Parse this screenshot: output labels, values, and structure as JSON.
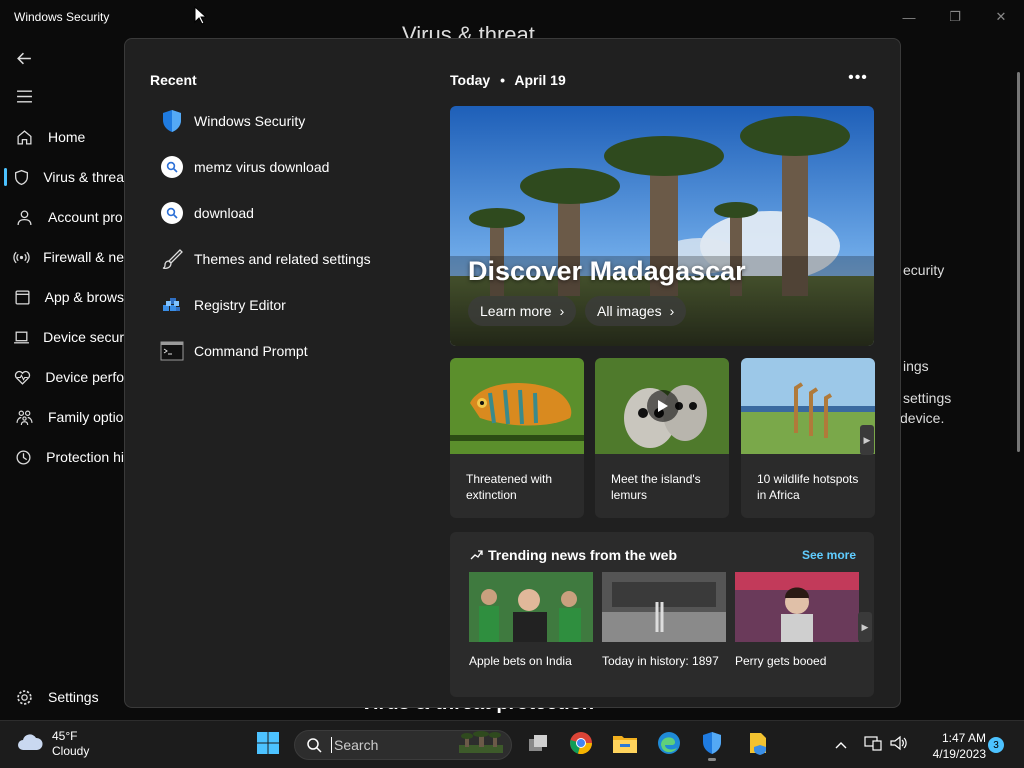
{
  "window": {
    "title": "Windows Security",
    "top_title_fragment": "Virus & threat",
    "bottom_title_fragment": "Virus & threat protection"
  },
  "sidebar": {
    "items": [
      {
        "label": "Home",
        "icon": "home-icon"
      },
      {
        "label": "Virus & threa",
        "icon": "shield-icon",
        "active": true
      },
      {
        "label": "Account pro",
        "icon": "person-icon"
      },
      {
        "label": "Firewall & ne",
        "icon": "wifi-icon"
      },
      {
        "label": "App & brows",
        "icon": "app-icon"
      },
      {
        "label": "Device secur",
        "icon": "laptop-icon"
      },
      {
        "label": "Device perfo",
        "icon": "heart-icon"
      },
      {
        "label": "Family optio",
        "icon": "family-icon"
      },
      {
        "label": "Protection hi",
        "icon": "history-icon"
      }
    ],
    "settings_label": "Settings"
  },
  "background_right": {
    "line1": "ecurity",
    "line2": "ings",
    "line3": "settings",
    "line4": "device."
  },
  "recent": {
    "heading": "Recent",
    "items": [
      {
        "label": "Windows Security",
        "icon": "windows-security-icon"
      },
      {
        "label": "memz virus download",
        "icon": "search-icon"
      },
      {
        "label": "download",
        "icon": "search-icon"
      },
      {
        "label": "Themes and related settings",
        "icon": "brush-icon"
      },
      {
        "label": "Registry Editor",
        "icon": "registry-icon"
      },
      {
        "label": "Command Prompt",
        "icon": "cmd-icon"
      }
    ]
  },
  "today": {
    "label": "Today",
    "separator": "•",
    "date": "April 19",
    "more": "•••"
  },
  "hero": {
    "title": "Discover Madagascar",
    "learn_more": "Learn more",
    "all_images": "All images"
  },
  "cards": [
    {
      "caption": "Threatened with extinction"
    },
    {
      "caption": "Meet the island's lemurs"
    },
    {
      "caption": "10 wildlife hotspots in Africa"
    }
  ],
  "trending": {
    "heading": "Trending news from the web",
    "see_more": "See more",
    "items": [
      {
        "caption": "Apple bets on India"
      },
      {
        "caption": "Today in history: 1897"
      },
      {
        "caption": "Perry gets booed"
      }
    ]
  },
  "taskbar": {
    "weather_temp": "45°F",
    "weather_desc": "Cloudy",
    "search_placeholder": "Search",
    "time": "1:47 AM",
    "date": "4/19/2023",
    "notification_count": "3"
  },
  "colors": {
    "accent": "#4cc2ff",
    "link": "#60cdff",
    "flyout_bg": "#202020",
    "card_bg": "#2b2b2b"
  }
}
